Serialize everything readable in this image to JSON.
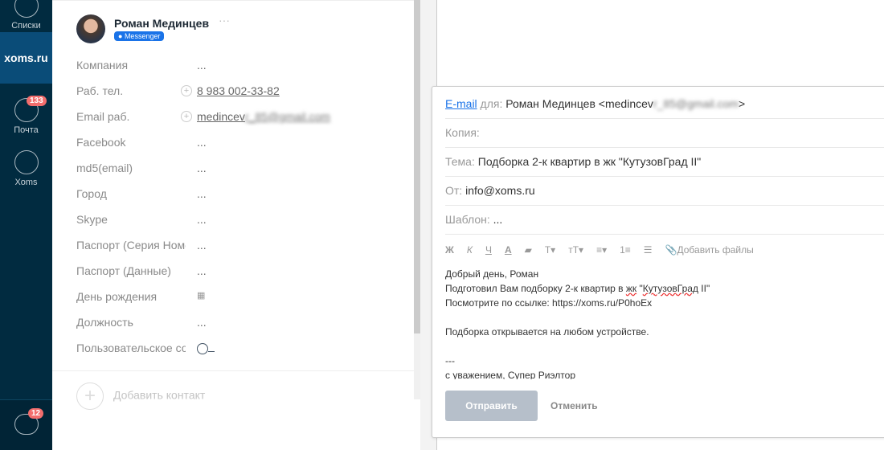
{
  "sidebar": {
    "lists": "Списки",
    "logo": "xoms.ru",
    "mail": "Почта",
    "mail_badge": "133",
    "xoms": "Xoms",
    "chat_badge": "12"
  },
  "contact": {
    "name": "Роман Мединцев",
    "more": "···",
    "messenger": "Messenger",
    "fields": [
      {
        "label": "Компания",
        "value": "..."
      },
      {
        "label": "Раб. тел.",
        "value": "8 983 002-33-82"
      },
      {
        "label": "Email раб.",
        "value": "medincev",
        "value_blurred": "r_85@gmail.com"
      },
      {
        "label": "Facebook",
        "value": "..."
      },
      {
        "label": "md5(email)",
        "value": "..."
      },
      {
        "label": "Город",
        "value": "..."
      },
      {
        "label": "Skype",
        "value": "..."
      },
      {
        "label": "Паспорт (Серия Номер)",
        "value": "..."
      },
      {
        "label": "Паспорт (Данные)",
        "value": "..."
      },
      {
        "label": "День рождения",
        "value": ""
      },
      {
        "label": "Должность",
        "value": "..."
      },
      {
        "label": "Пользовательское соглашение",
        "value": ""
      }
    ],
    "add_contact": "Добавить контакт"
  },
  "compose": {
    "email_link": "E-mail",
    "to_label": " для: ",
    "to_value": "Роман Мединцев <medincev",
    "to_blurred": "r_85@gmail.com",
    "to_end": ">",
    "cc_label": "Копия:",
    "subject_label": "Тема:",
    "subject": "Подборка 2-к квартир в жк \"КутузовГрад II\"",
    "from_label": "От:",
    "from": "info@xoms.ru",
    "template_label": "Шаблон:",
    "template": "...",
    "toolbar": {
      "bold": "Ж",
      "italic": "К",
      "underline": "Ч",
      "color": "A",
      "highlight": "▰",
      "font": "T▾",
      "size": "тT▾",
      "align": "≡▾",
      "ol": "1≡",
      "ul": "☰",
      "attach": "Добавить файлы"
    },
    "body": {
      "l1": "Добрый день, Роман",
      "l2a": "Подготовил Вам подборку 2-к квартир в ",
      "l2b": "жк",
      "l2c": " \"",
      "l2d": "КутузовГрад",
      "l2e": " II\"",
      "l3": "Посмотрите по ссылке: https://xoms.ru/P0hoEx",
      "l4": "Подборка открывается на любом устройстве.",
      "l5": "---",
      "l6": "с уважением, Супер Риэлтор"
    },
    "send": "Отправить",
    "cancel": "Отменить"
  }
}
